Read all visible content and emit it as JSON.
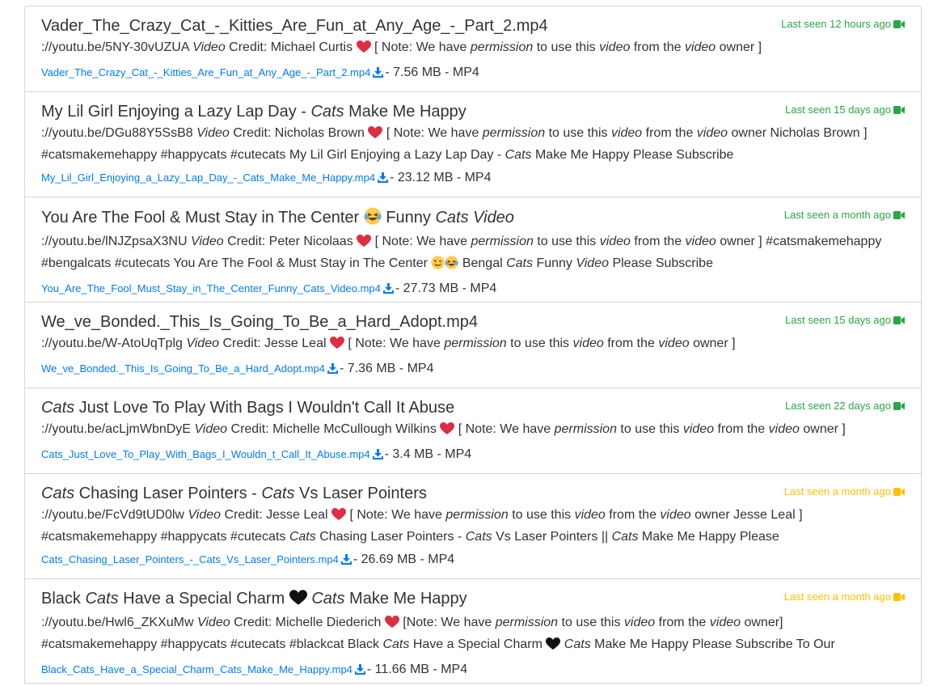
{
  "items": [
    {
      "title": "Vader_The_Crazy_Cat_-_Kitties_Are_Fun_at_Any_Age_-_Part_2.mp4",
      "seen": "Last seen 12 hours ago",
      "seen_color": "#28a745",
      "desc": {
        "url": "://youtu.be/5NY-30vUZUA",
        "credit": "Credit: Michael Curtis",
        "note_a": "[ Note: We have",
        "note_b": "to use this",
        "note_c": "from the",
        "note_d": "owner ]"
      },
      "file": "Vader_The_Crazy_Cat_-_Kitties_Are_Fun_at_Any_Age_-_Part_2.mp4",
      "size": "- 7.56 MB - MP4"
    },
    {
      "title_a": "My Lil Girl Enjoying a Lazy Lap Day - ",
      "title_em": "Cats",
      "title_b": " Make Me Happy",
      "seen": "Last seen 15 days ago",
      "seen_color": "#28a745",
      "desc": {
        "url": "://youtu.be/DGu88Y5SsB8",
        "credit": "Credit: Nicholas Brown",
        "note_a": "[ Note: We have",
        "note_b": "to use this",
        "note_c": "from the",
        "note_d": "owner Nicholas Brown ]",
        "line2_a": "#catsmakemehappy #happycats #cutecats My Lil Girl Enjoying a Lazy Lap Day - ",
        "line2_b": " Make Me Happy Please Subscribe"
      },
      "file": "My_Lil_Girl_Enjoying_a_Lazy_Lap_Day_-_Cats_Make_Me_Happy.mp4",
      "size": "- 23.12 MB - MP4"
    },
    {
      "title_a": "You Are The Fool & Must Stay in The Center ",
      "title_b": " Funny ",
      "title_em1": "Cats",
      "title_em2": "Video",
      "seen": "Last seen a month ago",
      "seen_color": "#28a745",
      "desc": {
        "url": "://youtu.be/lNJZpsaX3NU",
        "credit": "Credit: Peter Nicolaas",
        "note_a": "[ Note: We have",
        "note_b": "to use this",
        "note_c": "from the",
        "note_d": "owner ] #catsmakemehappy",
        "line2_a": "#bengalcats #cutecats You Are The Fool & Must Stay in The Center ",
        "line2_b": " Bengal ",
        "line2_c": " Funny ",
        "line2_d": " Please Subscribe"
      },
      "file": "You_Are_The_Fool_Must_Stay_in_The_Center_Funny_Cats_Video.mp4",
      "size": "- 27.73 MB - MP4"
    },
    {
      "title": "We_ve_Bonded._This_Is_Going_To_Be_a_Hard_Adopt.mp4",
      "seen": "Last seen 15 days ago",
      "seen_color": "#28a745",
      "desc": {
        "url": "://youtu.be/W-AtoUqTplg",
        "credit": "Credit: Jesse Leal",
        "note_a": "[ Note: We have",
        "note_b": "to use this",
        "note_c": "from the",
        "note_d": "owner ]"
      },
      "file": "We_ve_Bonded._This_Is_Going_To_Be_a_Hard_Adopt.mp4",
      "size": "- 7.36 MB - MP4"
    },
    {
      "title_em": "Cats",
      "title_b": " Just Love To Play With Bags I Wouldn't Call It Abuse",
      "seen": "Last seen 22 days ago",
      "seen_color": "#28a745",
      "desc": {
        "url": "://youtu.be/acLjmWbnDyE",
        "credit": "Credit: Michelle McCullough Wilkins",
        "note_a": "[ Note: We have",
        "note_b": "to use this",
        "note_c": "from the",
        "note_d": "owner ]"
      },
      "file": "Cats_Just_Love_To_Play_With_Bags_I_Wouldn_t_Call_It_Abuse.mp4",
      "size": "- 3.4 MB - MP4"
    },
    {
      "title_em": "Cats",
      "title_b": " Chasing Laser Pointers - ",
      "title_c": " Vs Laser Pointers",
      "seen": "Last seen a month ago",
      "seen_color": "#ffc107",
      "desc": {
        "url": "://youtu.be/FcVd9tUD0lw",
        "credit": "Credit: Jesse Leal",
        "note_a": "[ Note: We have",
        "note_b": "to use this",
        "note_c": "from the",
        "note_d": "owner Jesse Leal ]",
        "line2_a": "#catsmakemehappy #happycats #cutecats ",
        "line2_b": " Chasing Laser Pointers - ",
        "line2_c": " Vs Laser Pointers || ",
        "line2_d": " Make Me Happy Please"
      },
      "file": "Cats_Chasing_Laser_Pointers_-_Cats_Vs_Laser_Pointers.mp4",
      "size": "- 26.69 MB - MP4"
    },
    {
      "title_a": "Black ",
      "title_em": "Cats",
      "title_b": " Have a Special Charm ",
      "title_c": " Make Me Happy",
      "seen": "Last seen a month ago",
      "seen_color": "#ffc107",
      "desc": {
        "url": "://youtu.be/Hwl6_ZKXuMw",
        "credit": "Credit: Michelle Diederich",
        "note_a": "[Note: We have",
        "note_b": "to use this",
        "note_c": "from the",
        "note_d": "owner] #catsmakemehappy",
        "line2_a": "#happycats #cutecats #blackcat Black ",
        "line2_b": " Have a Special Charm ",
        "line2_c": " Make Me Happy Please Subscribe To Our"
      },
      "file": "Black_Cats_Have_a_Special_Charm_Cats_Make_Me_Happy.mp4",
      "size": "- 11.66 MB - MP4"
    }
  ],
  "words": {
    "video": "Video",
    "video_lc": "video",
    "permission": "permission",
    "cats": "Cats"
  },
  "icons": {
    "camera": "video-camera-icon",
    "download": "download-icon",
    "heart": "red-heart-emoji",
    "black_heart": "black-heart-emoji",
    "laugh": "laughing-emoji",
    "wink": "winking-emoji"
  }
}
